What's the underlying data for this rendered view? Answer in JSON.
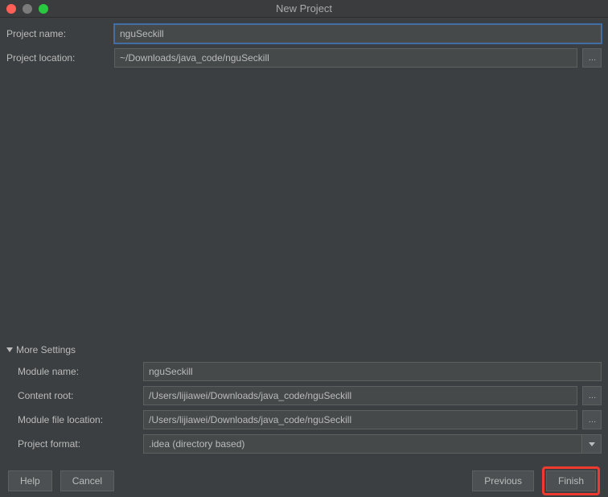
{
  "window": {
    "title": "New Project"
  },
  "top": {
    "projectNameLabel": "Project name:",
    "projectNameValue": "nguSeckill",
    "projectLocationLabel": "Project location:",
    "projectLocationValue": "~/Downloads/java_code/nguSeckill"
  },
  "more": {
    "header": "More Settings",
    "moduleNameLabel": "Module name:",
    "moduleNameValue": "nguSeckill",
    "contentRootLabel": "Content root:",
    "contentRootValue": "/Users/lijiawei/Downloads/java_code/nguSeckill",
    "moduleFileLocationLabel": "Module file location:",
    "moduleFileLocationValue": "/Users/lijiawei/Downloads/java_code/nguSeckill",
    "projectFormatLabel": "Project format:",
    "projectFormatValue": ".idea (directory based)"
  },
  "footer": {
    "help": "Help",
    "cancel": "Cancel",
    "previous": "Previous",
    "finish": "Finish"
  }
}
